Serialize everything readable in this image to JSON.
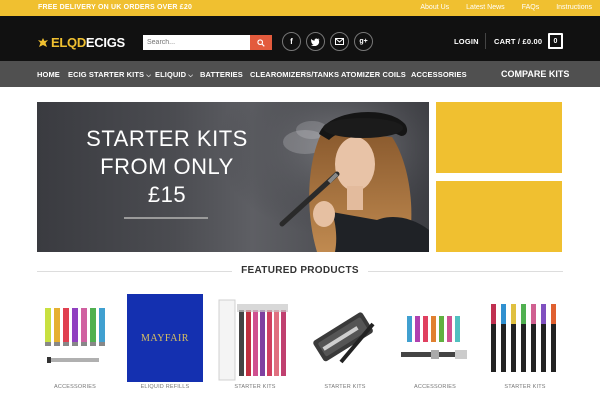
{
  "topbar": {
    "promo": "FREE DELIVERY ON UK ORDERS OVER £20",
    "links": [
      "About Us",
      "Latest News",
      "FAQs",
      "Instructions"
    ]
  },
  "header": {
    "logo_part1": "ELQD",
    "logo_part2": "ECIGS",
    "search_placeholder": "Search...",
    "social_icons": [
      "facebook-icon",
      "twitter-icon",
      "email-icon",
      "google-plus-icon"
    ],
    "login": "LOGIN",
    "cart": "CART / £0.00",
    "cart_count": "0"
  },
  "nav": {
    "items": [
      "HOME",
      "ECIG STARTER KITS",
      "ELIQUID",
      "BATTERIES",
      "CLEAROMIZERS/TANKS",
      "ATOMIZER COILS",
      "ACCESSORIES"
    ],
    "compare": "COMPARE KITS"
  },
  "hero": {
    "line1": "STARTER KITS",
    "line2": "FROM ONLY",
    "line3": "£15"
  },
  "featured": {
    "title": "FEATURED PRODUCTS",
    "products": [
      {
        "category": "ACCESSORIES"
      },
      {
        "category": "ELIQUID REFILLS",
        "image_text": "MAYFAIR"
      },
      {
        "category": "STARTER KITS"
      },
      {
        "category": "STARTER KITS"
      },
      {
        "category": "ACCESSORIES"
      },
      {
        "category": "STARTER KITS"
      }
    ]
  },
  "colors": {
    "accent": "#f0c030",
    "header_bg": "#111111",
    "nav_bg": "#505050",
    "search_button": "#e35b3d"
  }
}
